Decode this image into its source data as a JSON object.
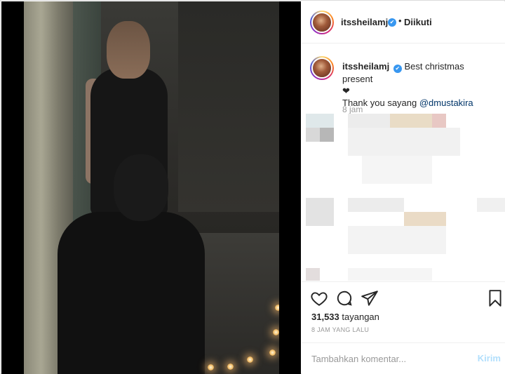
{
  "header": {
    "username": "itssheilamj",
    "verified_glyph": "✔",
    "separator": "•",
    "follow_status": "Diikuti"
  },
  "caption": {
    "username": "itssheilamj",
    "line1": "Best christmas present",
    "heart": "❤",
    "line2_prefix": "Thank you sayang ",
    "mention": "@dmustakira",
    "time": "8 jam"
  },
  "actions": {
    "icons": [
      "heart-outline-icon",
      "comment-icon",
      "share-icon",
      "bookmark-icon"
    ],
    "views_count": "31,533",
    "views_label": "tayangan",
    "posted_ago": "8 JAM YANG LALU"
  },
  "comment_box": {
    "placeholder": "Tambahkan komentar...",
    "post_label": "Kirim"
  },
  "colors": {
    "verified": "#3897f0",
    "mention": "#003569",
    "post_button": "#b2dffc",
    "muted": "#999999"
  }
}
